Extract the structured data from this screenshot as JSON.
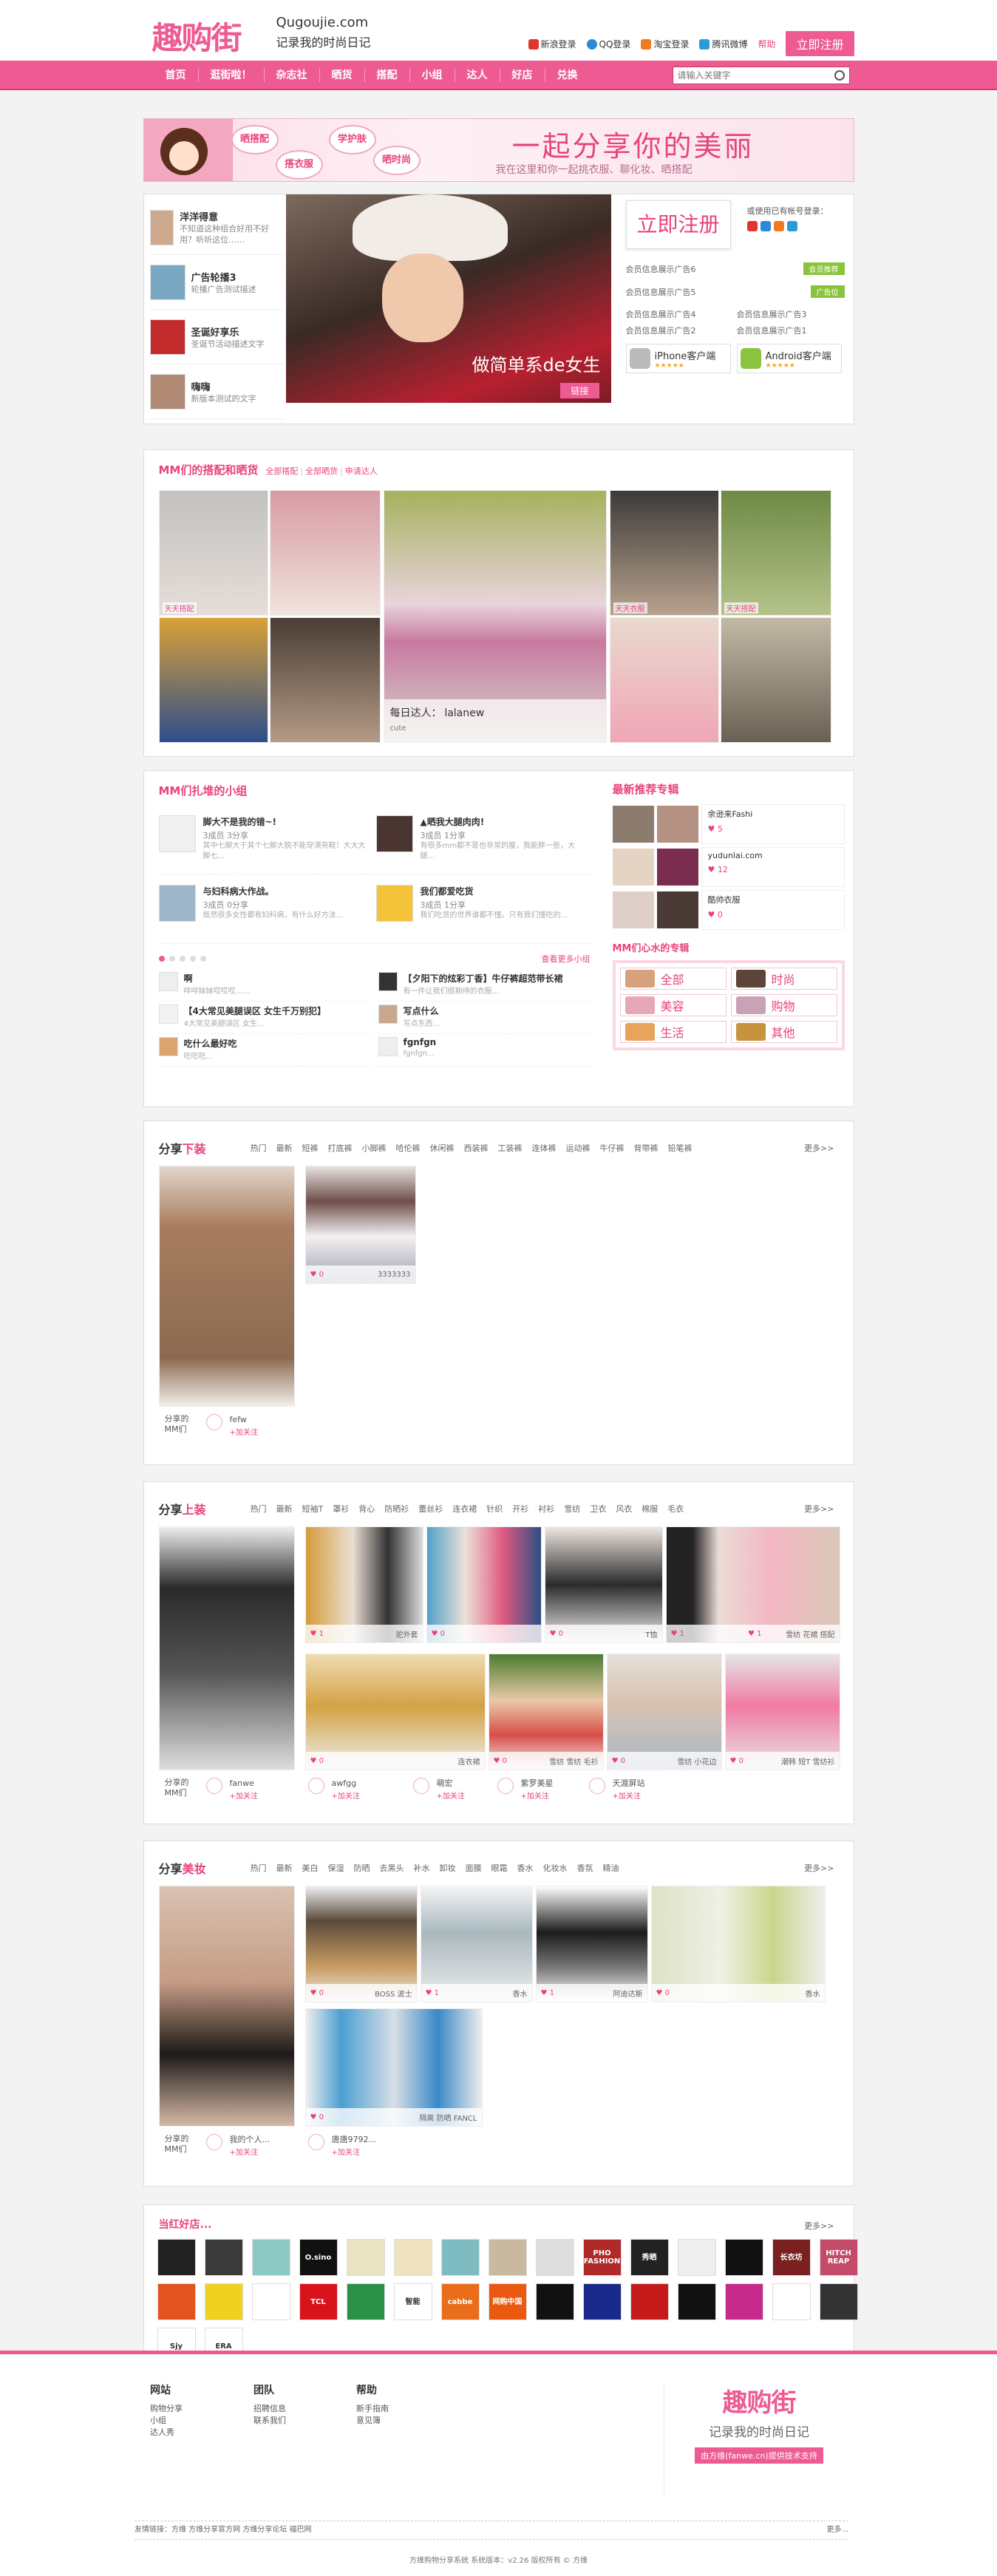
{
  "header": {
    "logo_cn": "趣购街",
    "logo_domain": "Qugoujie.com",
    "logo_slogan": "记录我的时尚日记",
    "logins": [
      "新浪登录",
      "QQ登录",
      "淘宝登录",
      "腾讯微博"
    ],
    "help": "帮助",
    "register": "立即注册"
  },
  "nav": {
    "items": [
      "首页",
      "逛街啦！",
      "杂志社",
      "晒货",
      "搭配",
      "小组",
      "达人",
      "好店",
      "兑换"
    ],
    "search_placeholder": "请输入关键字"
  },
  "banner": {
    "bubbles": [
      "晒搭配",
      "学护肤",
      "搭衣服",
      "晒时尚"
    ],
    "headline": "一起分享你的美丽",
    "subline": "我在这里和你一起挑衣服、聊化妆、晒搭配"
  },
  "hero": {
    "list": [
      {
        "title": "洋洋得意",
        "desc": "不知道这种组合好用不好用？听听这位……"
      },
      {
        "title": "广告轮播3",
        "desc": "轮播广告测试描述"
      },
      {
        "title": "圣诞好享乐",
        "desc": "圣诞节活动描述文字"
      },
      {
        "title": "嗨嗨",
        "desc": "新版本测试的文字"
      }
    ],
    "caption": "做简单系de女生",
    "caption_btn": "链接",
    "big_reg": "立即注册",
    "other_login": "或使用已有帐号登录：",
    "members": [
      {
        "text": "会员信息展示广告6",
        "tag": "会员推荐"
      },
      {
        "text": "会员信息展示广告5",
        "tag": "广告位"
      }
    ],
    "members2": [
      "会员信息展示广告4",
      "会员信息展示广告3",
      "会员信息展示广告2",
      "会员信息展示广告1"
    ],
    "apps": [
      {
        "name": "iPhone客户端"
      },
      {
        "name": "Android客户端"
      }
    ],
    "stars": "★★★★★"
  },
  "mm": {
    "title": "MM们的搭配和晒货",
    "tabs": [
      "全部搭配",
      "全部晒货",
      "申请达人"
    ],
    "labels": [
      "天天搭配",
      "",
      "",
      "",
      "天天衣服",
      "天天搭配",
      "",
      "",
      "",
      "",
      "",
      ""
    ],
    "daren": "每日达人：",
    "daren_name": "lalanew",
    "daren_sub": "cute"
  },
  "groups": {
    "title": "MM们扎堆的小组",
    "items": [
      {
        "t": "脚大不是我的错~!",
        "m": "3成员   3分享",
        "p": "其中七脚大于其个七脚大脱不能穿漂亮鞋！大大大脚七..."
      },
      {
        "t": "▲晒我大腿肉肉!",
        "m": "3成员   1分享",
        "p": "有很多mm都不是也非常的瘦，我能胖一些，大腿..."
      },
      {
        "t": "与妇科病大作战。",
        "m": "3成员   0分享",
        "p": "既然很多女性都有妇科病，有什么好方法..."
      },
      {
        "t": "我们都爱吃货",
        "m": "3成员   1分享",
        "p": "我们吃货的世界谁都不懂。只有我们懂吃的..."
      }
    ],
    "more": "查看更多小组",
    "small": [
      {
        "t": "啊",
        "s": "咩咩妹妹哎哎哎……"
      },
      {
        "t": "【夕阳下的炫彩丁香】牛仔裤超范带长裙",
        "s": "有一件让我们很期待的衣服..."
      },
      {
        "t": "【4大常见美腿误区 女生千万别犯】",
        "s": "4大常见美腿误区 女生..."
      },
      {
        "t": "写点什么",
        "s": "写点东西..."
      },
      {
        "t": "吃什么最好吃",
        "s": "吃吃吃..."
      },
      {
        "t": "fgnfgn",
        "s": "fgnfgn..."
      }
    ],
    "shops_title": "最新推荐专辑",
    "shops": [
      {
        "n": "余逊来Fashi",
        "h": "5"
      },
      {
        "n": "yudunlai.com",
        "h": "12"
      },
      {
        "n": "酷帅衣服",
        "h": "0"
      }
    ],
    "cats_title": "MM们心水的专辑",
    "cats": [
      "全部",
      "时尚",
      "美容",
      "购物",
      "生活",
      "其他"
    ]
  },
  "sec1": {
    "title_a": "分享",
    "title_b": "下装",
    "tags": [
      "热门",
      "最新",
      "短裤",
      "打底裤",
      "小脚裤",
      "哈伦裤",
      "休闲裤",
      "西装裤",
      "工装裤",
      "连体裤",
      "运动裤",
      "牛仔裤",
      "背带裤",
      "铅笔裤"
    ],
    "more": "更多>>",
    "posts": [
      {
        "h": "",
        "c": ""
      },
      {
        "h": "0",
        "c": "3333333"
      }
    ],
    "sharers": [
      {
        "lab": "分享的MM们",
        "nm": "fefw",
        "fl": "+加关注"
      }
    ]
  },
  "sec2": {
    "title_a": "分享",
    "title_b": "上装",
    "tags": [
      "热门",
      "最新",
      "短袖T",
      "罩衫",
      "背心",
      "防晒衫",
      "蕾丝衫",
      "连衣裙",
      "针织",
      "开衫",
      "衬衫",
      "雪纺",
      "卫衣",
      "风衣",
      "棉服",
      "毛衣"
    ],
    "more": "更多>>",
    "posts": [
      {
        "h": "",
        "c": ""
      },
      {
        "h": "1",
        "c": "驼外套"
      },
      {
        "h": "0",
        "c": ""
      },
      {
        "h": "0",
        "c": "T恤"
      },
      {
        "h": "1",
        "c": ""
      },
      {
        "h": "1",
        "c": "雪纺 花裙 搭配"
      },
      {
        "h": "0",
        "c": "连衣裙"
      },
      {
        "h": "0",
        "c": "雪纺 雪纺 毛衫"
      },
      {
        "h": "0",
        "c": "雪纺 小花边"
      },
      {
        "h": "0",
        "c": "潮韩 短T 雪纺衫"
      }
    ],
    "sharers": [
      {
        "lab": "分享的MM们",
        "nm": "fanwe",
        "fl": "+加关注"
      },
      {
        "nm": "awfgg",
        "fl": "+加关注"
      },
      {
        "nm": "萌宏",
        "fl": "+加关注"
      },
      {
        "nm": "紫罗美星",
        "fl": "+加关注"
      },
      {
        "nm": "天渡屏站",
        "fl": "+加关注"
      }
    ]
  },
  "sec3": {
    "title_a": "分享",
    "title_b": "美妆",
    "tags": [
      "热门",
      "最新",
      "美白",
      "保湿",
      "防晒",
      "去黑头",
      "补水",
      "卸妆",
      "面膜",
      "眼霜",
      "香水",
      "化妆水",
      "香氛",
      "精油"
    ],
    "more": "更多>>",
    "posts": [
      {
        "h": "",
        "c": ""
      },
      {
        "h": "0",
        "c": "BOSS 波士"
      },
      {
        "h": "1",
        "c": "香水"
      },
      {
        "h": "1",
        "c": "阿迪达斯"
      },
      {
        "h": "0",
        "c": "香水"
      },
      {
        "h": "0",
        "c": "隔离 防晒 FANCL"
      }
    ],
    "sharers": [
      {
        "lab": "分享的MM们",
        "nm": "我的个人...",
        "fl": "+加关注"
      },
      {
        "nm": "唐唐9792...",
        "fl": "+加关注"
      }
    ]
  },
  "stores": {
    "title": "当红好店...",
    "more": "更多>>",
    "logos": [
      "",
      "",
      "",
      "O.sino",
      "",
      "",
      "",
      "",
      "",
      "PHO FASHION",
      "秀晒",
      "",
      "",
      "长衣坊",
      "HITCH REAP",
      "",
      "",
      "",
      "TCL",
      "",
      "智能",
      "cabbe",
      "网购中国",
      "",
      "",
      "",
      "",
      "",
      "",
      "",
      "Sjy",
      "ERA"
    ]
  },
  "footer": {
    "cols": [
      {
        "h": "网站",
        "items": [
          "购物分享",
          "小组",
          "达人秀"
        ]
      },
      {
        "h": "团队",
        "items": [
          "招聘信息",
          "联系我们"
        ]
      },
      {
        "h": "帮助",
        "items": [
          "新手指南",
          "意见簿"
        ]
      }
    ],
    "logo": "趣购街",
    "slogan": "记录我的时尚日记",
    "powered": "由方维(fanwe.cn)提供技术支持",
    "links": "友情链接：方维   方维分享官方网   方维分享论坛   福巴网",
    "links_more": "更多...",
    "copy": "方维购物分享系统  系统版本：v2.26  版权所有 © 方维"
  }
}
